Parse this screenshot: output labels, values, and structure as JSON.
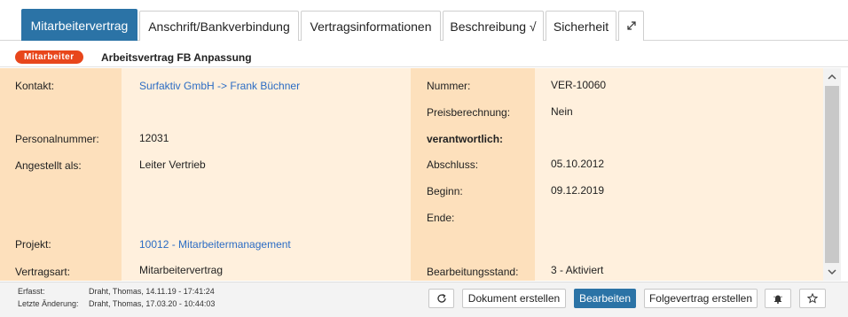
{
  "tabs": [
    {
      "label": "Mitarbeitervertrag"
    },
    {
      "label": "Anschrift/Bankverbindung"
    },
    {
      "label": "Vertragsinformationen"
    },
    {
      "label": "Beschreibung √"
    },
    {
      "label": "Sicherheit"
    }
  ],
  "header": {
    "badge": "Mitarbeiter",
    "title": "Arbeitsvertrag FB Anpassung"
  },
  "left_fields": {
    "kontakt_label": "Kontakt:",
    "kontakt_value": "Surfaktiv GmbH -> Frank Büchner",
    "personalnummer_label": "Personalnummer:",
    "personalnummer_value": "12031",
    "angestellt_label": "Angestellt als:",
    "angestellt_value": "Leiter Vertrieb",
    "projekt_label": "Projekt:",
    "projekt_value": "10012 - Mitarbeitermanagement",
    "vertragsart_label": "Vertragsart:",
    "vertragsart_value": "Mitarbeitervertrag"
  },
  "right_fields": {
    "nummer_label": "Nummer:",
    "nummer_value": "VER-10060",
    "preis_label": "Preisberechnung:",
    "preis_value": "Nein",
    "verantwortlich_label": "verantwortlich:",
    "abschluss_label": "Abschluss:",
    "abschluss_value": "05.10.2012",
    "beginn_label": "Beginn:",
    "beginn_value": "09.12.2019",
    "ende_label": "Ende:",
    "stand_label": "Bearbeitungsstand:",
    "stand_value": "3 - Aktiviert"
  },
  "footer": {
    "erfasst_label": "Erfasst:",
    "erfasst_value": "Draht, Thomas, 14.11.19 - 17:41:24",
    "aenderung_label": "Letzte Änderung:",
    "aenderung_value": "Draht, Thomas, 17.03.20 - 10:44:03",
    "buttons": {
      "dokument": "Dokument erstellen",
      "bearbeiten": "Bearbeiten",
      "folgevertrag": "Folgevertrag erstellen"
    }
  },
  "colors": {
    "accent": "#2b73a6",
    "badge": "#e8461b",
    "label_column": "#fde0bc",
    "value_column": "#fff0dd",
    "link": "#2b6cc4"
  },
  "icons": [
    "expand-icon",
    "refresh-icon",
    "bell-icon",
    "star-icon",
    "scroll-up-icon",
    "scroll-down-icon"
  ]
}
